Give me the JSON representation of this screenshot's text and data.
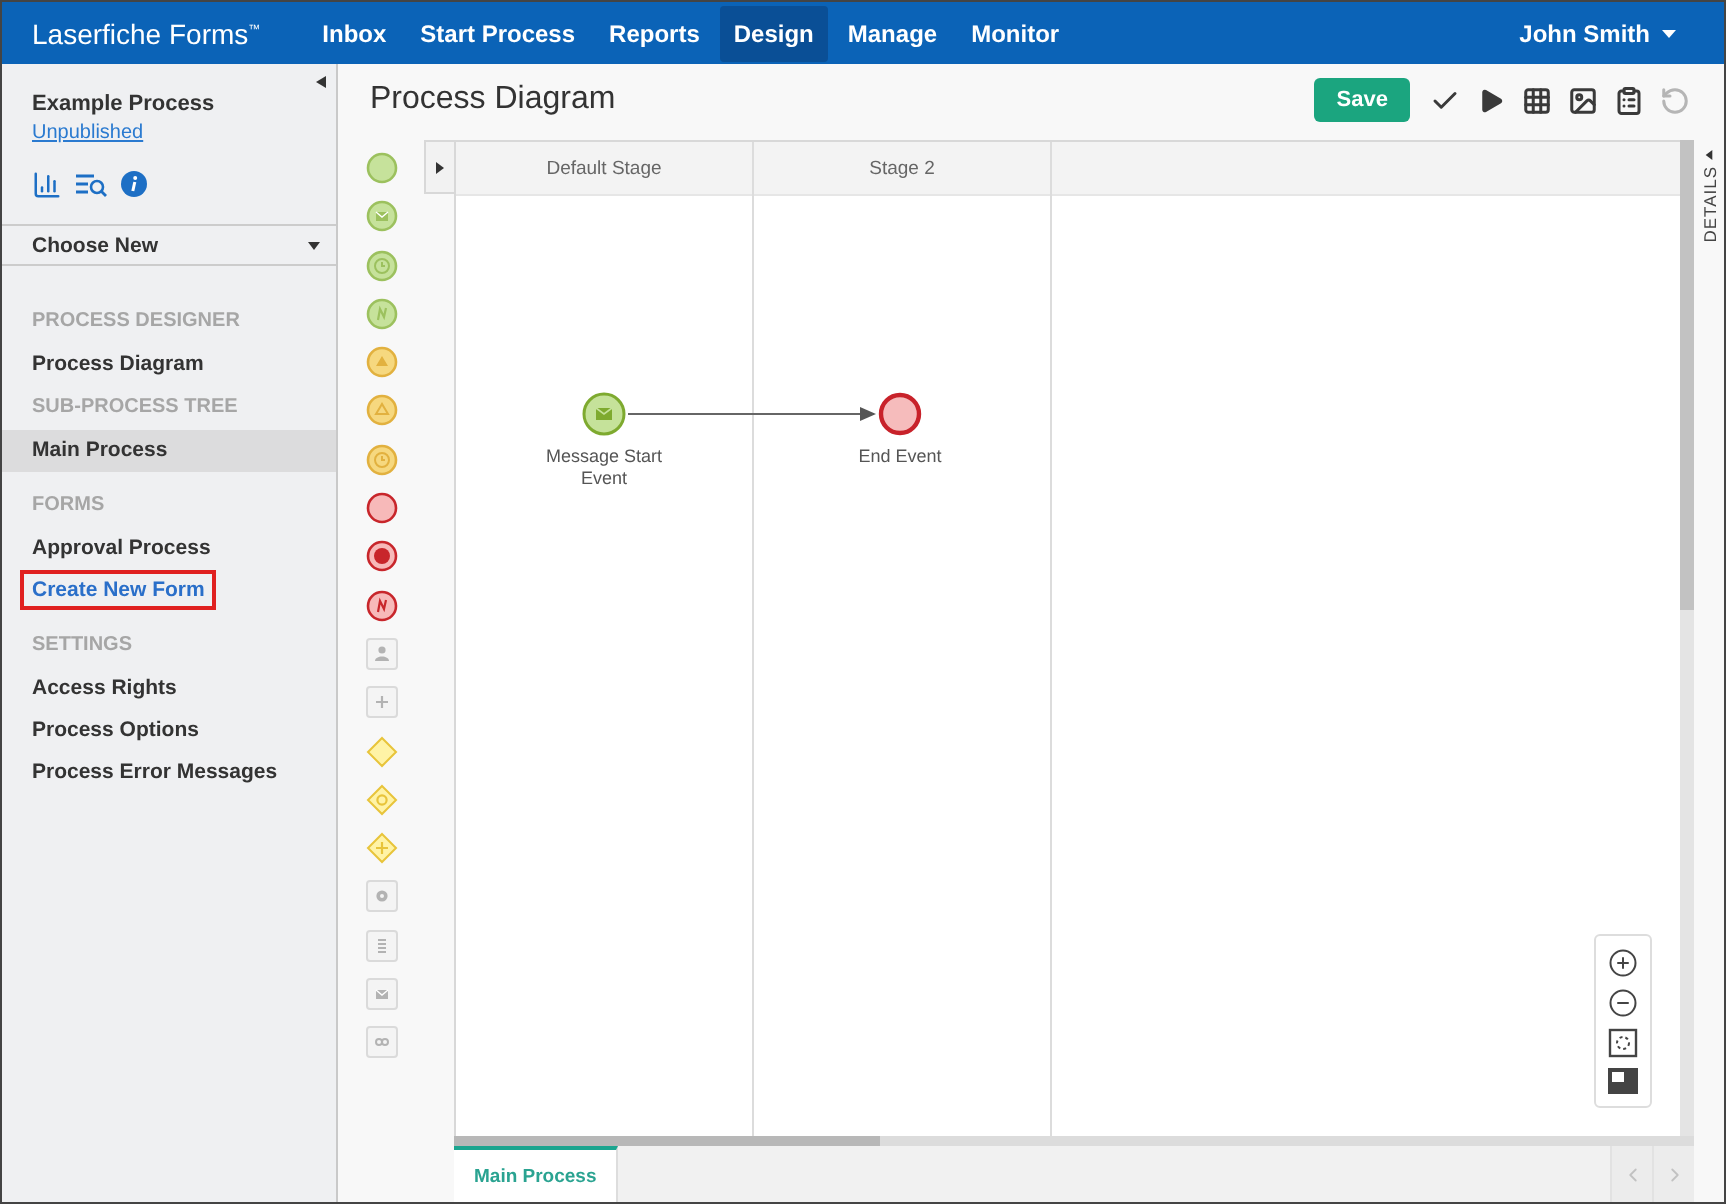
{
  "navbar": {
    "brand": "Laserfiche Forms$^{™}$",
    "items": [
      {
        "label": "Inbox",
        "selected": false
      },
      {
        "label": "Start Process",
        "selected": false
      },
      {
        "label": "Reports",
        "selected": false
      },
      {
        "label": "Design",
        "selected": true
      },
      {
        "label": "Manage",
        "selected": false
      },
      {
        "label": "Monitor",
        "selected": false
      }
    ],
    "user": "John Smith"
  },
  "sidebar": {
    "process_name": "Example Process",
    "status_link": "Unpublished",
    "choose_new": "Choose New",
    "sections": [
      {
        "heading": "PROCESS DESIGNER",
        "items": [
          {
            "label": "Process Diagram",
            "kind": "page",
            "selected": false,
            "outlined": false
          }
        ]
      },
      {
        "heading": "SUB-PROCESS TREE",
        "items": [
          {
            "label": "Main Process",
            "kind": "page",
            "selected": true,
            "outlined": false
          }
        ]
      },
      {
        "heading": "FORMS",
        "items": [
          {
            "label": "Approval Process",
            "kind": "page",
            "selected": false,
            "outlined": false
          },
          {
            "label": "Create New Form",
            "kind": "link",
            "selected": false,
            "outlined": true
          }
        ]
      },
      {
        "heading": "SETTINGS",
        "items": [
          {
            "label": "Access Rights",
            "kind": "page",
            "selected": false,
            "outlined": false
          },
          {
            "label": "Process Options",
            "kind": "page",
            "selected": false,
            "outlined": false
          },
          {
            "label": "Process Error Messages",
            "kind": "page",
            "selected": false,
            "outlined": false
          }
        ]
      }
    ]
  },
  "page_title": "Process Diagram",
  "toolbar": {
    "save": "Save",
    "buttons": [
      {
        "disabled": false
      },
      {
        "disabled": false
      },
      {
        "disabled": false
      },
      {
        "disabled": false
      },
      {
        "disabled": false
      },
      {
        "disabled": true
      }
    ]
  },
  "diagram": {
    "stages": [
      {
        "label": "Default Stage",
        "nodes": [
          {
            "kind": "message_start",
            "label": "Message Start Event"
          }
        ]
      },
      {
        "label": "Stage 2",
        "nodes": [
          {
            "kind": "end",
            "label": "End Event"
          }
        ]
      }
    ]
  },
  "details_tab": "DETAILS",
  "bottom_tabs": [
    {
      "label": "Main Process",
      "selected": true
    }
  ]
}
